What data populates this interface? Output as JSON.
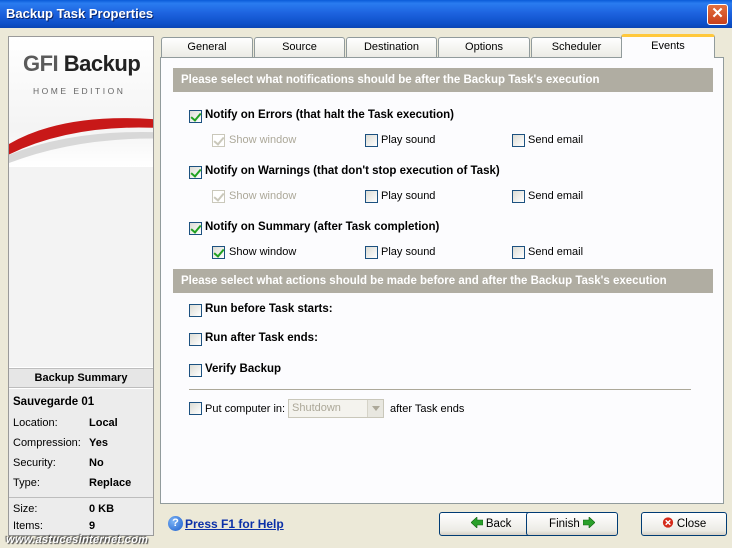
{
  "window": {
    "title": "Backup Task Properties",
    "close_glyph": "✕"
  },
  "logo": {
    "brand_light": "GFI",
    "brand_dark": "Backup",
    "edition": "HOME EDITION"
  },
  "summary": {
    "heading": "Backup Summary",
    "task_name": "Sauvegarde 01",
    "rows": [
      {
        "key": "Location:",
        "value": "Local"
      },
      {
        "key": "Compression:",
        "value": "Yes"
      },
      {
        "key": "Security:",
        "value": "No"
      },
      {
        "key": "Type:",
        "value": "Replace"
      },
      {
        "key": "Size:",
        "value": "0 KB"
      },
      {
        "key": "Items:",
        "value": "9"
      }
    ]
  },
  "tabs": [
    "General",
    "Source",
    "Destination",
    "Options",
    "Scheduler",
    "Events"
  ],
  "active_tab": "Events",
  "notifications": {
    "heading": "Please select what notifications should be after the Backup Task's execution",
    "groups": [
      {
        "label": "Notify on Errors  (that halt the Task execution)",
        "checked": true,
        "show_window": "Show window",
        "play_sound": "Play sound",
        "send_email": "Send email"
      },
      {
        "label": "Notify on Warnings  (that don't stop execution of Task)",
        "checked": true,
        "show_window": "Show window",
        "play_sound": "Play sound",
        "send_email": "Send email"
      },
      {
        "label": "Notify on Summary  (after Task completion)",
        "checked": true,
        "show_window": "Show window",
        "play_sound": "Play sound",
        "send_email": "Send email"
      }
    ]
  },
  "actions": {
    "heading": "Please select what actions should be made before and after the Backup Task's execution",
    "run_before": "Run before Task starts:",
    "run_after": "Run after Task ends:",
    "verify": "Verify Backup",
    "put_computer": "Put computer in:",
    "put_computer_value": "Shutdown",
    "after_task": "after Task ends"
  },
  "footer": {
    "help": "Press F1 for Help",
    "back": "Back",
    "finish": "Finish",
    "close": "Close",
    "watermark": "www.astucesinternet.com"
  },
  "colors": {
    "title_bar": "#0a5bd8",
    "section_header": "#b0ada2",
    "active_tab_accent": "#ffc83c",
    "link": "#0b30a8"
  }
}
